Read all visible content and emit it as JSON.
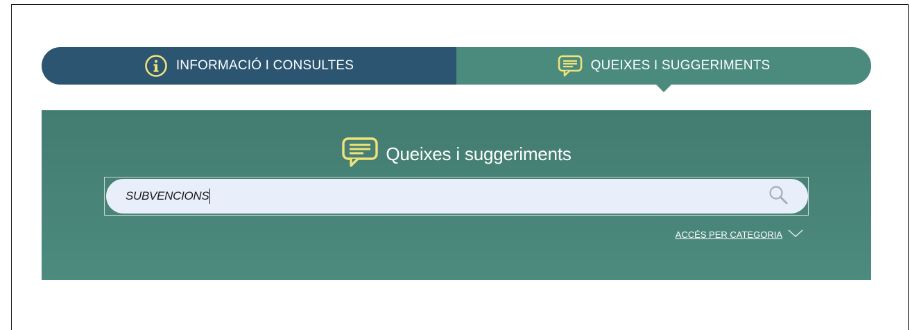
{
  "tabs": {
    "info": {
      "label": "INFORMACIÓ I CONSULTES",
      "icon": "info-circle-icon"
    },
    "queixes": {
      "label": "QUEIXES I SUGGERIMENTS",
      "icon": "chat-bubble-icon",
      "active": true
    }
  },
  "panel": {
    "title": "Queixes i suggeriments",
    "title_icon": "chat-bubble-icon",
    "search": {
      "value": "SUBVENCIONS",
      "icon": "search-icon"
    },
    "category_link": {
      "label": "ACCÉS PER CATEGORIA",
      "icon": "chevron-down-icon"
    }
  },
  "colors": {
    "tab_info_bg": "#2c5571",
    "tab_queixes_bg": "#4a8b7e",
    "panel_bg": "#4a877a",
    "icon_yellow": "#f1e27a",
    "search_bg": "#e8eefa"
  }
}
